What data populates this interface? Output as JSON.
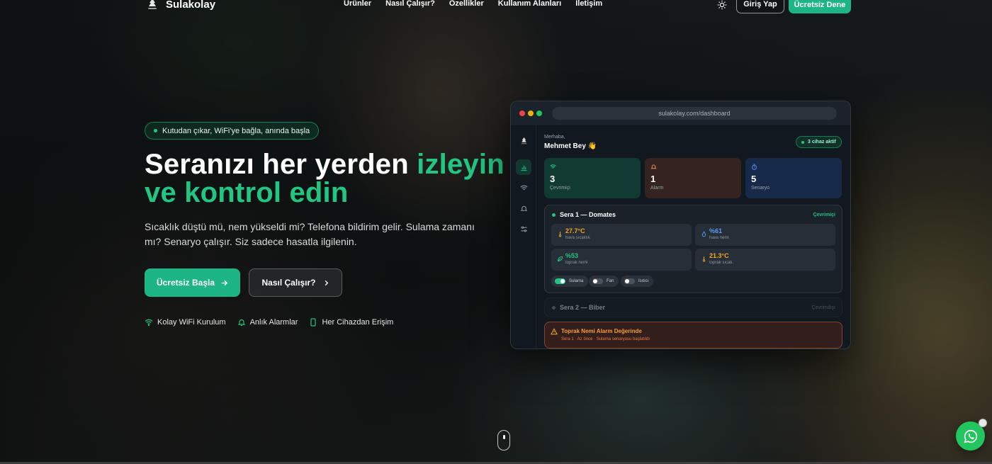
{
  "nav": {
    "brand": "Sulakolay",
    "links": [
      "Ürünler",
      "Nasıl Çalışır?",
      "Özellikler",
      "Kullanım Alanları",
      "İletişim"
    ],
    "login": "Giriş Yap",
    "trial": "Ücretsiz Dene"
  },
  "hero": {
    "badge": "Kutudan çıkar, WiFi'ye bağla, anında başla",
    "title_white": "Seranızı her yerden ",
    "title_accent_1": "izleyin",
    "title_accent_2": "ve kontrol edin",
    "subtitle": "Sıcaklık düştü mü, nem yükseldi mi? Telefona bildirim gelir. Sulama zamanı mı? Senaryo çalışır. Siz sadece hasatla ilgilenin.",
    "cta_primary": "Ücretsiz Başla",
    "cta_secondary": "Nasıl Çalışır?",
    "features": [
      "Kolay WiFi Kurulum",
      "Anlık Alarmlar",
      "Her Cihazdan Erişim"
    ]
  },
  "dashboard": {
    "url": "sulakolay.com/dashboard",
    "greeting": "Merhaba,",
    "user": "Mehmet Bey",
    "wave": "👋",
    "active_devices": "3 cihaz aktif",
    "stats": [
      {
        "value": "3",
        "label": "Çevrimiçi",
        "color": "#22c582"
      },
      {
        "value": "1",
        "label": "Alarm",
        "color": "#f08a4b"
      },
      {
        "value": "5",
        "label": "Senaryo",
        "color": "#4e8ef7"
      }
    ],
    "sera1": {
      "title": "Sera 1 — Domates",
      "status": "Çevrimiçi",
      "sensors": [
        {
          "value": "27.7°C",
          "label": "hava sıcaklık",
          "color": "#f5a623"
        },
        {
          "value": "%61",
          "label": "hava nemi",
          "color": "#5b9df5"
        },
        {
          "value": "%53",
          "label": "toprak nemi",
          "color": "#22c582"
        },
        {
          "value": "21.3°C",
          "label": "toprak sıcak.",
          "color": "#f5a623"
        }
      ],
      "toggles": [
        {
          "label": "Sulama",
          "on": true
        },
        {
          "label": "Fan",
          "on": false
        },
        {
          "label": "Isıtıcı",
          "on": false
        }
      ]
    },
    "sera2": {
      "title": "Sera 2 — Biber",
      "status": "Çevrimdışı"
    },
    "alarm": {
      "title": "Toprak Nemi Alarm Değerinde",
      "detail": "Sera 1 · Az önce · Sulama senaryosu başlatıldı"
    }
  },
  "colors": {
    "accent": "#1db584",
    "alarm": "#f59e3b",
    "whatsapp": "#22c55e"
  }
}
